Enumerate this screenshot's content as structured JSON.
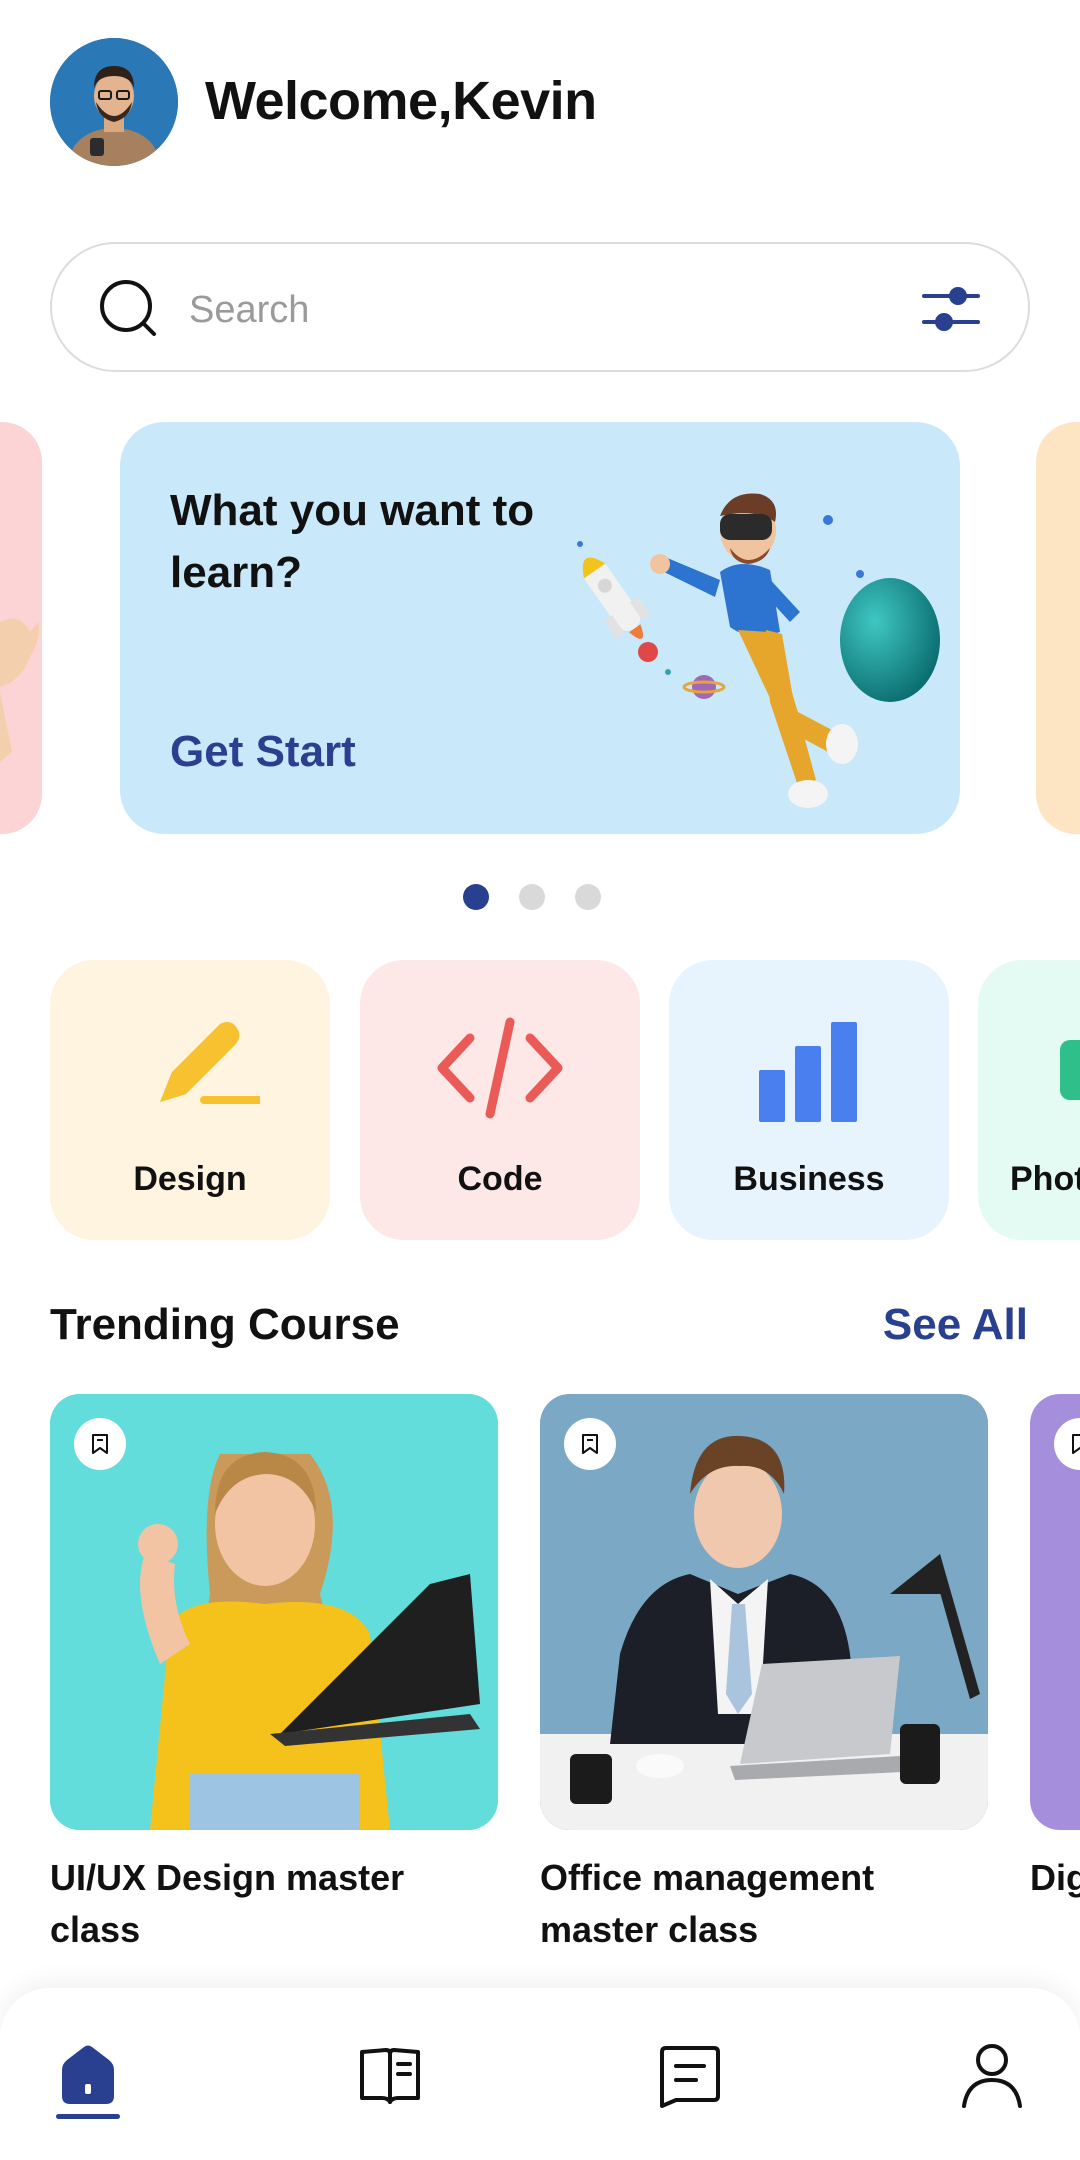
{
  "header": {
    "welcome_text": "Welcome,Kevin",
    "avatar_icon": "user-avatar"
  },
  "search": {
    "placeholder": "Search",
    "value": "",
    "search_icon": "search-icon",
    "filter_icon": "filter-sliders-icon"
  },
  "banner": {
    "title": "What you want to learn?",
    "cta_label": "Get Start",
    "bg_color": "#c9e9fb",
    "cta_color": "#28408f"
  },
  "carousel": {
    "dots": [
      {
        "active": true
      },
      {
        "active": false
      },
      {
        "active": false
      }
    ]
  },
  "categories": [
    {
      "label": "Design",
      "icon": "pencil-icon",
      "bg": "#fff4df",
      "icon_color": "#f7c230"
    },
    {
      "label": "Code",
      "icon": "code-icon",
      "bg": "#fde7e7",
      "icon_color": "#ea5b57"
    },
    {
      "label": "Business",
      "icon": "bar-chart-icon",
      "bg": "#e7f3fd",
      "icon_color": "#4a7ff0"
    },
    {
      "label": "Phot",
      "icon": "photo-icon",
      "bg": "#e3fbf2",
      "icon_color": "#2fbf8a"
    }
  ],
  "trending": {
    "title": "Trending Course",
    "see_all_label": "See All",
    "courses": [
      {
        "title": "UI/UX Design master class",
        "bg": "#5fd9da"
      },
      {
        "title": "Office management master class",
        "bg": "#7fa9c4"
      },
      {
        "title": "Dig ma",
        "bg": "#a58fdc"
      }
    ]
  },
  "bottom_nav": {
    "items": [
      {
        "icon": "home-icon",
        "active": true
      },
      {
        "icon": "book-icon",
        "active": false
      },
      {
        "icon": "document-icon",
        "active": false
      },
      {
        "icon": "profile-icon",
        "active": false
      }
    ],
    "accent_color": "#28408f"
  }
}
